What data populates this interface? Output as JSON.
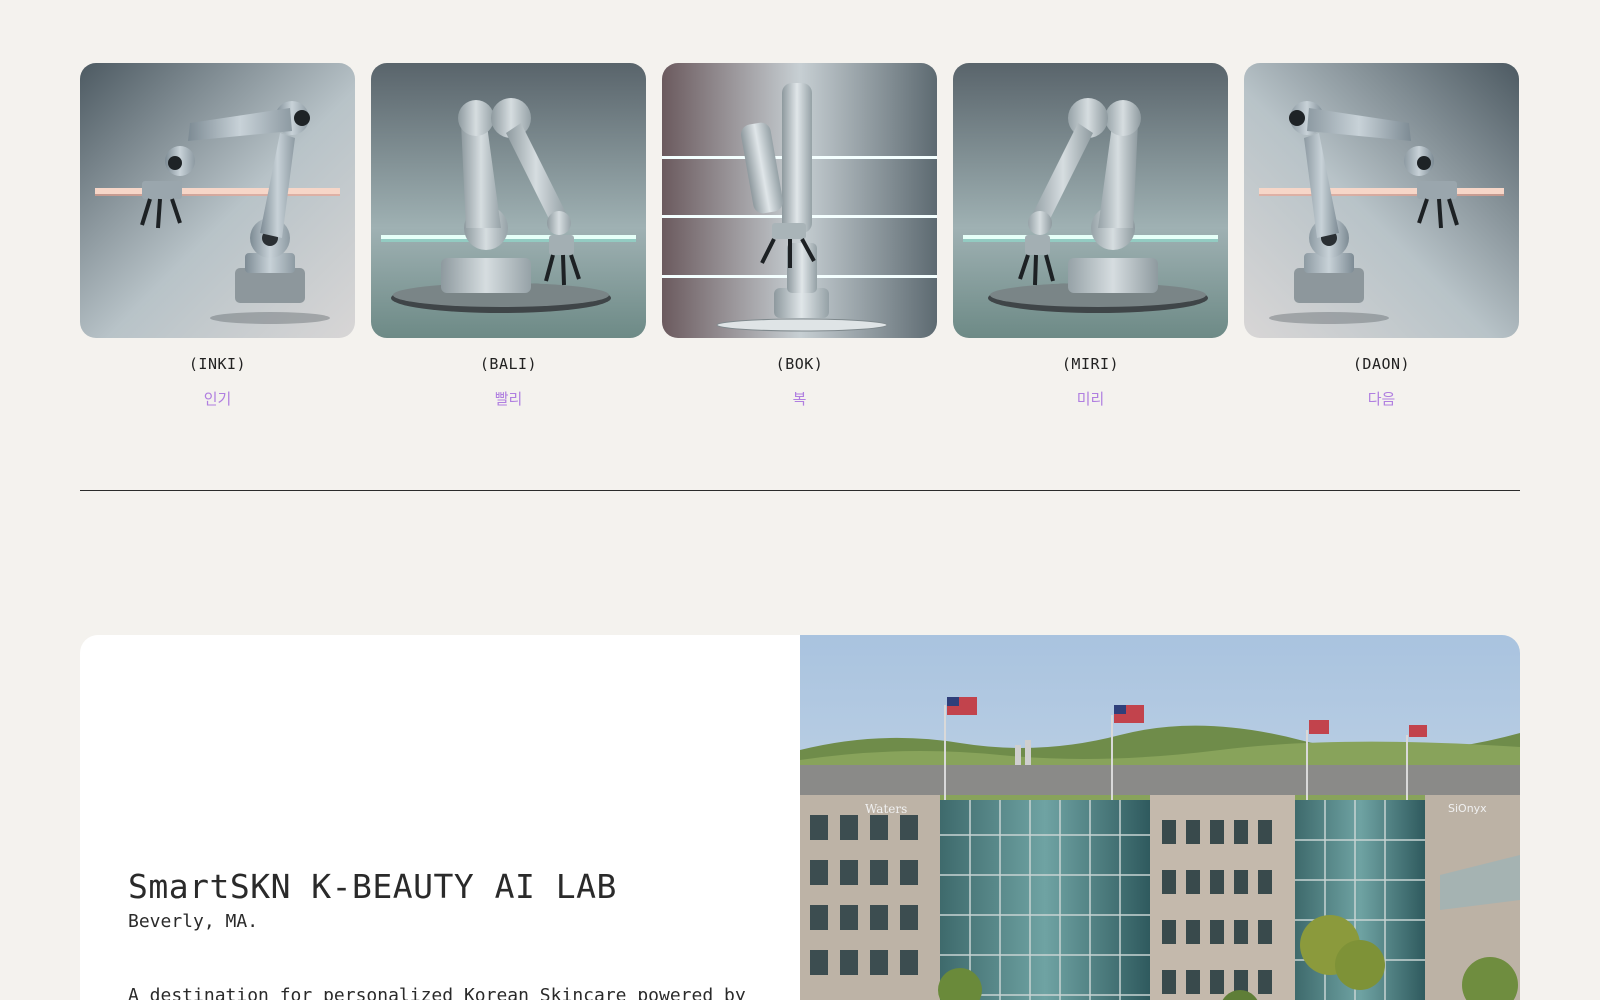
{
  "robots": [
    {
      "code": "(INKI)",
      "name": "인기",
      "image": "robot-arm-warm-light"
    },
    {
      "code": "(BALI)",
      "name": "빨리",
      "image": "robot-arm-teal-light"
    },
    {
      "code": "(BOK)",
      "name": "복",
      "image": "robot-arm-three-lights"
    },
    {
      "code": "(MIRI)",
      "name": "미리",
      "image": "robot-arm-teal-light-mirrored"
    },
    {
      "code": "(DAON)",
      "name": "다음",
      "image": "robot-arm-warm-light-mirrored"
    }
  ],
  "lab": {
    "title": "SmartSKN K-BEAUTY AI LAB",
    "location": "Beverly, MA.",
    "description": "A destination for personalized Korean Skincare powered by",
    "photo": {
      "image": "campus-building-photo",
      "signs": [
        "Waters",
        "SiOnyx"
      ]
    }
  },
  "colors": {
    "background": "#f4f2ee",
    "accent_korean": "#b07fe0",
    "divider": "#2b2b2b"
  }
}
